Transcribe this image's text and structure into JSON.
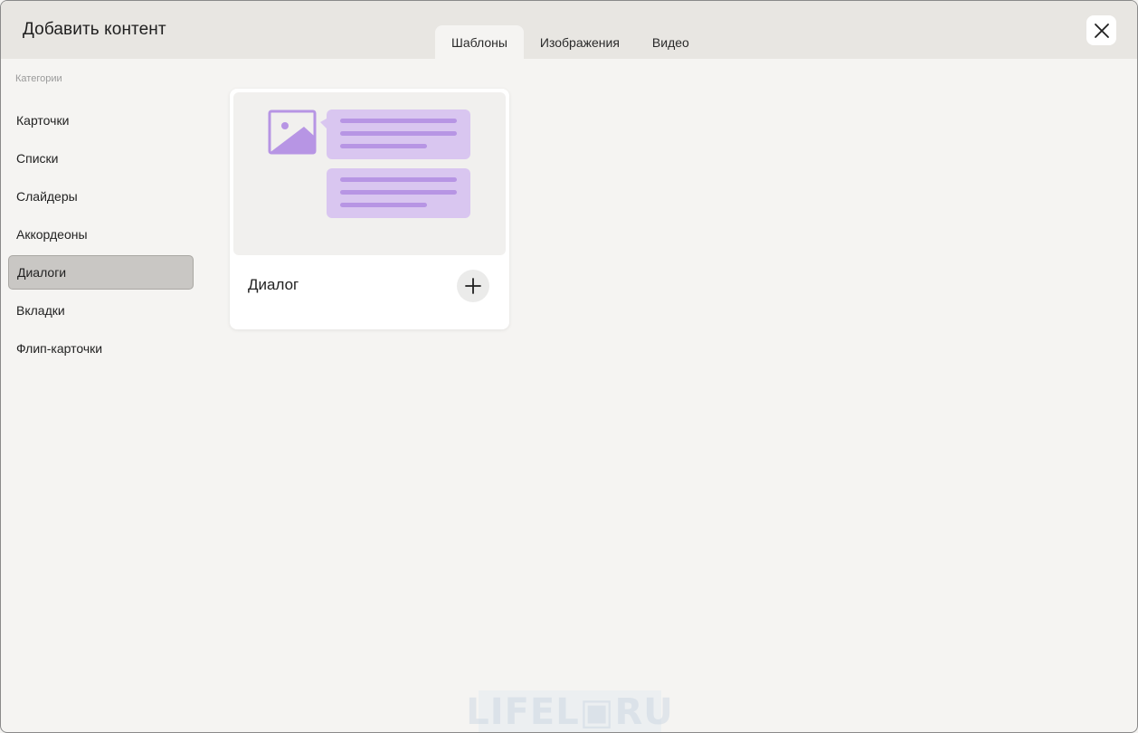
{
  "dialog": {
    "title": "Добавить контент",
    "close_icon": "close-icon"
  },
  "tabs": [
    {
      "label": "Шаблоны",
      "active": true
    },
    {
      "label": "Изображения",
      "active": false
    },
    {
      "label": "Видео",
      "active": false
    }
  ],
  "sidebar": {
    "heading": "Категории",
    "items": [
      {
        "label": "Карточки",
        "active": false
      },
      {
        "label": "Списки",
        "active": false
      },
      {
        "label": "Слайдеры",
        "active": false
      },
      {
        "label": "Аккордеоны",
        "active": false
      },
      {
        "label": "Диалоги",
        "active": true
      },
      {
        "label": "Вкладки",
        "active": false
      },
      {
        "label": "Флип-карточки",
        "active": false
      }
    ]
  },
  "templates": [
    {
      "title": "Диалог",
      "preview_icon": "dialog-illustration",
      "action_icon": "plus-icon"
    }
  ],
  "watermark": "LIFEL▣RU",
  "colors": {
    "accent_purple": "#b795e4",
    "accent_purple_light": "#d9c6f0",
    "header_bg": "#e8e6e2",
    "active_category_bg": "#c9c7c4"
  }
}
